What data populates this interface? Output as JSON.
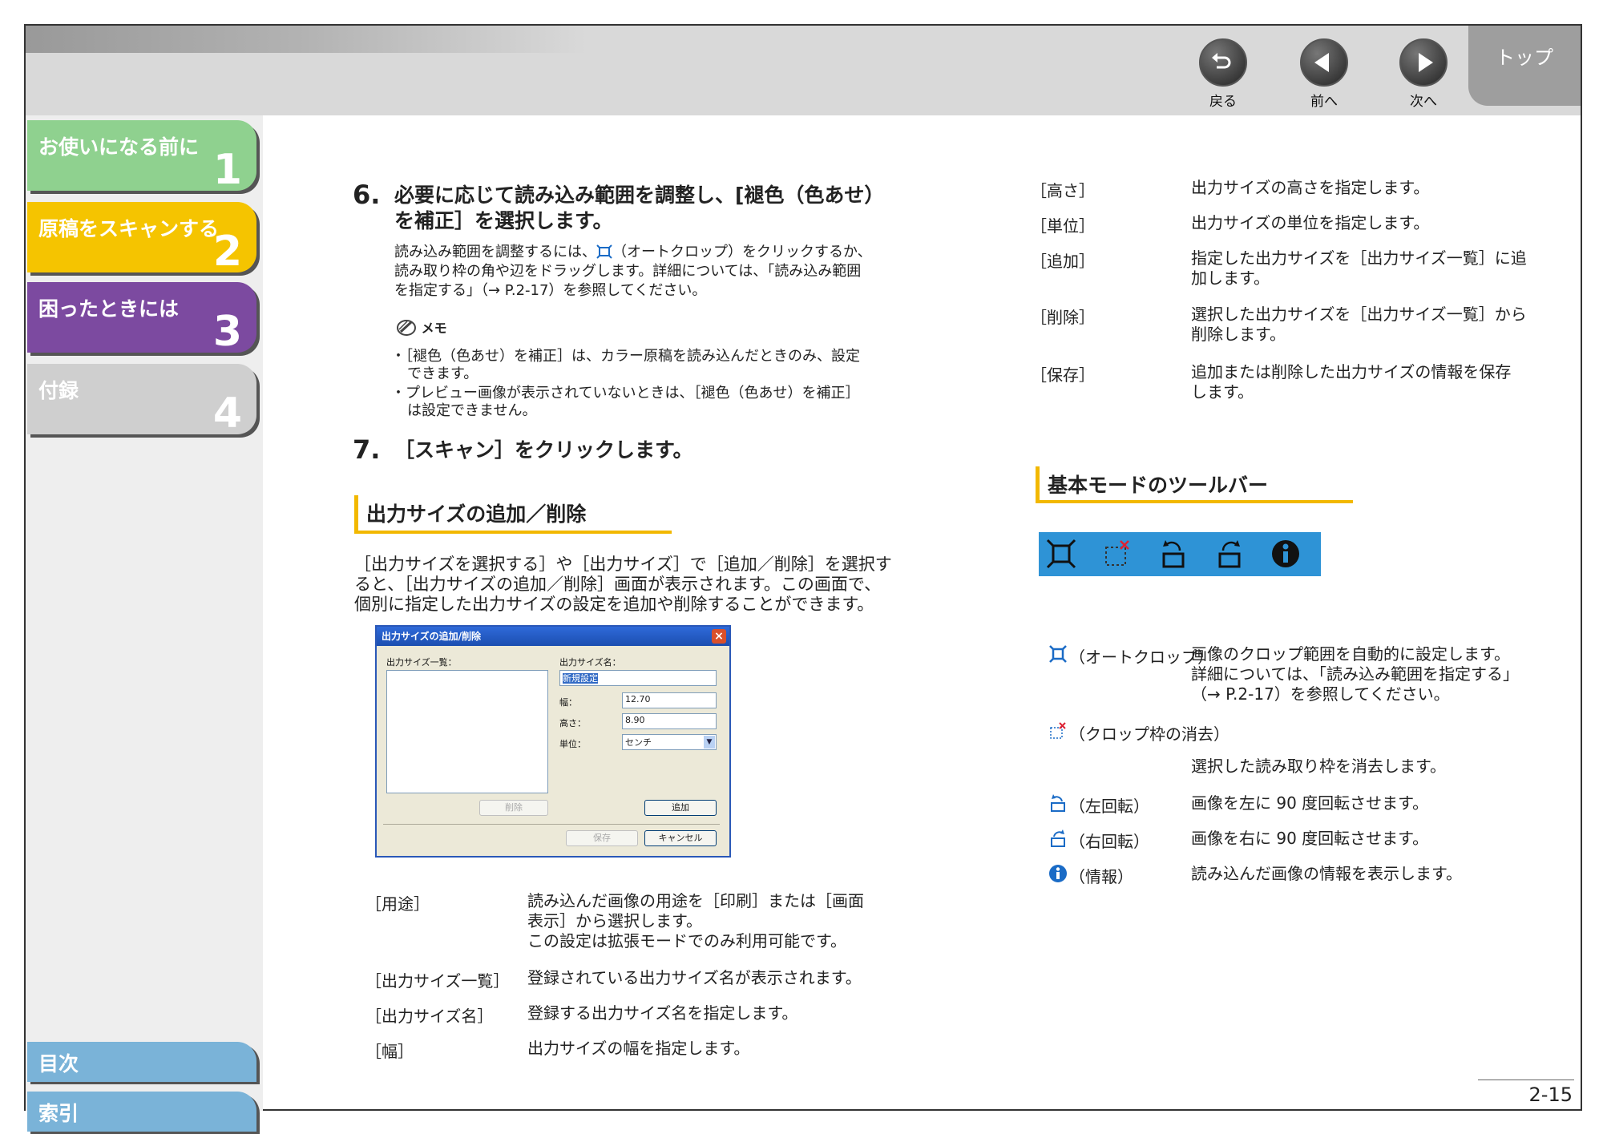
{
  "nav": {
    "back_label": "戻る",
    "prev_label": "前へ",
    "next_label": "次へ",
    "top_label": "トップ"
  },
  "sidebar": {
    "chapters": [
      {
        "label": "お使いになる前に",
        "num": "1",
        "color": "#8fd18f"
      },
      {
        "label": "原稿をスキャンする",
        "num": "2",
        "color": "#f5c400"
      },
      {
        "label": "困ったときには",
        "num": "3",
        "color": "#7c4aa0"
      },
      {
        "label": "付録",
        "num": "4",
        "color": "#cfcfcf"
      }
    ],
    "toc_label": "目次",
    "index_label": "索引"
  },
  "step6": {
    "num": "6.",
    "title_line1": "必要に応じて読み込み範囲を調整し、[褪色（色あせ）",
    "title_line2": "を補正］を選択します。",
    "body_line1": "読み込み範囲を調整するには、",
    "body_line1b": "（オートクロップ）をクリックするか、",
    "body_line2": "読み取り枠の角や辺をドラッグします。詳細については、「読み込み範囲",
    "body_line3": "を指定する」（→ P.2-17）を参照してください。",
    "memo_label": "メモ",
    "memo1_line1": "・［褪色（色あせ）を補正］は、カラー原稿を読み込んだときのみ、設定",
    "memo1_line2": "できます。",
    "memo2_line1": "・プレビュー画像が表示されていないときは、［褪色（色あせ）を補正］",
    "memo2_line2": "は設定できません。"
  },
  "step7": {
    "num": "7.",
    "title": "［スキャン］をクリックします。"
  },
  "section_add": {
    "title": "出力サイズの追加／削除",
    "para_line1": "［出力サイズを選択する］や［出力サイズ］で［追加／削除］を選択す",
    "para_line2": "ると、［出力サイズの追加／削除］画面が表示されます。この画面で、",
    "para_line3": "個別に指定した出力サイズの設定を追加や削除することができます。"
  },
  "dialog": {
    "title": "出力サイズの追加/削除",
    "list_label": "出力サイズ一覧：",
    "name_label": "出力サイズ名：",
    "name_value": "新規設定",
    "width_label": "幅：",
    "width_value": "12.70",
    "height_label": "高さ：",
    "height_value": "8.90",
    "unit_label": "単位：",
    "unit_value": "センチ",
    "delete_btn": "削除",
    "add_btn": "追加",
    "save_btn": "保存",
    "cancel_btn": "キャンセル"
  },
  "left_terms": [
    {
      "term": "［用途］",
      "desc": [
        "読み込んだ画像の用途を［印刷］または［画面",
        "表示］から選択します。",
        "この設定は拡張モードでのみ利用可能です。"
      ]
    },
    {
      "term": "［出力サイズ一覧］",
      "desc": [
        "登録されている出力サイズ名が表示されます。"
      ]
    },
    {
      "term": "［出力サイズ名］",
      "desc": [
        "登録する出力サイズ名を指定します。"
      ]
    },
    {
      "term": "［幅］",
      "desc": [
        "出力サイズの幅を指定します。"
      ]
    }
  ],
  "right_terms": [
    {
      "term": "［高さ］",
      "desc": [
        "出力サイズの高さを指定します。"
      ]
    },
    {
      "term": "［単位］",
      "desc": [
        "出力サイズの単位を指定します。"
      ]
    },
    {
      "term": "［追加］",
      "desc": [
        "指定した出力サイズを［出力サイズ一覧］に追",
        "加します。"
      ]
    },
    {
      "term": "［削除］",
      "desc": [
        "選択した出力サイズを［出力サイズ一覧］から",
        "削除します。"
      ]
    },
    {
      "term": "［保存］",
      "desc": [
        "追加または削除した出力サイズの情報を保存",
        "します。"
      ]
    }
  ],
  "section_toolbar": {
    "title": "基本モードのツールバー"
  },
  "tools": [
    {
      "icon": "auto-crop-icon",
      "label": "（オートクロップ）",
      "desc": [
        "画像のクロップ範囲を自動的に設定します。",
        "詳細については、「読み込み範囲を指定する」",
        "（→ P.2-17）を参照してください。"
      ]
    },
    {
      "icon": "clear-crop-icon",
      "label": "（クロップ枠の消去）",
      "desc": [
        "選択した読み取り枠を消去します。"
      ]
    },
    {
      "icon": "rotate-left-icon",
      "label": "（左回転）",
      "desc": [
        "画像を左に 90 度回転させます。"
      ]
    },
    {
      "icon": "rotate-right-icon",
      "label": "（右回転）",
      "desc": [
        "画像を右に 90 度回転させます。"
      ]
    },
    {
      "icon": "info-icon",
      "label": "（情報）",
      "desc": [
        "読み込んだ画像の情報を表示します。"
      ]
    }
  ],
  "page_number": "2-15"
}
